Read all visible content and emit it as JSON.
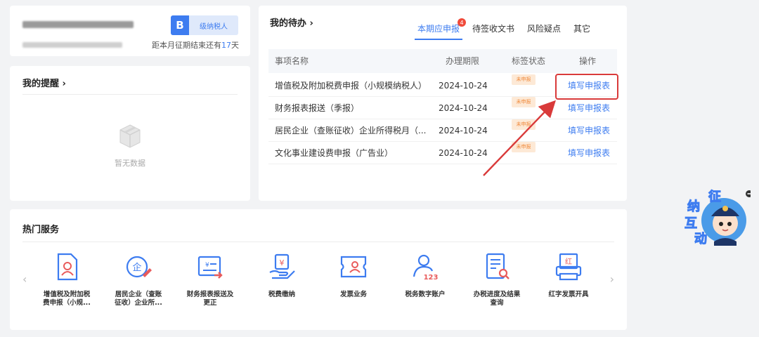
{
  "profile": {
    "badge_letter": "B",
    "badge_text": "级纳税人",
    "deadline_prefix": "距本月征期结束还有",
    "deadline_days": "17",
    "deadline_suffix": "天"
  },
  "reminder": {
    "title": "我的提醒 ›",
    "empty_text": "暂无数据"
  },
  "todo": {
    "title": "我的待办 ›",
    "tabs": [
      {
        "label": "本期应申报",
        "badge": "4"
      },
      {
        "label": "待签收文书"
      },
      {
        "label": "风险疑点"
      },
      {
        "label": "其它"
      }
    ],
    "columns": [
      "事项名称",
      "办理期限",
      "标签状态",
      "操作"
    ],
    "rows": [
      {
        "name": "增值税及附加税费申报（小规模纳税人）",
        "deadline": "2024-10-24",
        "status": "未申报",
        "action": "填写申报表"
      },
      {
        "name": "财务报表报送（季报）",
        "deadline": "2024-10-24",
        "status": "未申报",
        "action": "填写申报表"
      },
      {
        "name": "居民企业（查账征收）企业所得税月（...",
        "deadline": "2024-10-24",
        "status": "未申报",
        "action": "填写申报表"
      },
      {
        "name": "文化事业建设费申报（广告业）",
        "deadline": "2024-10-24",
        "status": "未申报",
        "action": "填写申报表"
      }
    ]
  },
  "hot_services": {
    "title": "热门服务",
    "items": [
      {
        "label_line1": "增值税及附加税",
        "label_line2": "费申报（小规...",
        "icon": "document-person-icon"
      },
      {
        "label_line1": "居民企业（查账",
        "label_line2": "征收）企业所...",
        "icon": "enterprise-edit-icon"
      },
      {
        "label_line1": "财务报表报送及",
        "label_line2": "更正",
        "icon": "report-send-icon"
      },
      {
        "label_line1": "税费缴纳",
        "label_line2": "",
        "icon": "tax-payment-icon"
      },
      {
        "label_line1": "发票业务",
        "label_line2": "",
        "icon": "invoice-icon"
      },
      {
        "label_line1": "税务数字账户",
        "label_line2": "",
        "icon": "digital-account-icon"
      },
      {
        "label_line1": "办税进度及结果",
        "label_line2": "查询",
        "icon": "progress-query-icon"
      },
      {
        "label_line1": "红字发票开具",
        "label_line2": "",
        "icon": "red-invoice-icon"
      }
    ]
  },
  "mascot": {
    "line1": "征",
    "line2": "纳",
    "line3": "互",
    "line4": "动"
  },
  "colors": {
    "accent": "#3d7cf0",
    "highlight": "#d93a3a",
    "status_bg": "#fde9d6"
  }
}
